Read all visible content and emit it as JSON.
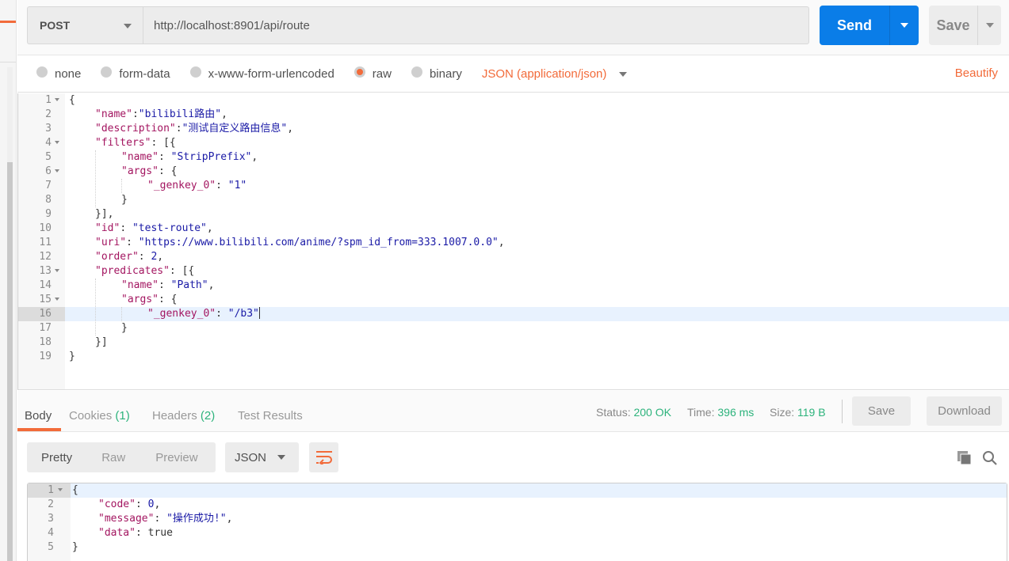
{
  "request": {
    "method": "POST",
    "url": "http://localhost:8901/api/route",
    "send_label": "Send",
    "save_label": "Save"
  },
  "body_options": {
    "modes": [
      {
        "label": "none",
        "selected": false
      },
      {
        "label": "form-data",
        "selected": false
      },
      {
        "label": "x-www-form-urlencoded",
        "selected": false
      },
      {
        "label": "raw",
        "selected": true
      },
      {
        "label": "binary",
        "selected": false
      }
    ],
    "content_type": "JSON (application/json)",
    "beautify_label": "Beautify"
  },
  "request_body": {
    "active_line": 16,
    "lines": [
      {
        "n": "1",
        "fold": true,
        "indent": 0,
        "tokens": [
          [
            "p",
            "{"
          ]
        ]
      },
      {
        "n": "2",
        "fold": false,
        "indent": 1,
        "tokens": [
          [
            "k",
            "\"name\""
          ],
          [
            "p",
            ":"
          ],
          [
            "s",
            "\"bilibili路由\""
          ],
          [
            "p",
            ","
          ]
        ]
      },
      {
        "n": "3",
        "fold": false,
        "indent": 1,
        "tokens": [
          [
            "k",
            "\"description\""
          ],
          [
            "p",
            ":"
          ],
          [
            "s",
            "\"测试自定义路由信息\""
          ],
          [
            "p",
            ","
          ]
        ]
      },
      {
        "n": "4",
        "fold": true,
        "indent": 1,
        "tokens": [
          [
            "k",
            "\"filters\""
          ],
          [
            "p",
            ": [{"
          ]
        ]
      },
      {
        "n": "5",
        "fold": false,
        "indent": 2,
        "tokens": [
          [
            "k",
            "\"name\""
          ],
          [
            "p",
            ": "
          ],
          [
            "s",
            "\"StripPrefix\""
          ],
          [
            "p",
            ","
          ]
        ]
      },
      {
        "n": "6",
        "fold": true,
        "indent": 2,
        "tokens": [
          [
            "k",
            "\"args\""
          ],
          [
            "p",
            ": {"
          ]
        ]
      },
      {
        "n": "7",
        "fold": false,
        "indent": 3,
        "tokens": [
          [
            "k",
            "\"_genkey_0\""
          ],
          [
            "p",
            ": "
          ],
          [
            "s",
            "\"1\""
          ]
        ]
      },
      {
        "n": "8",
        "fold": false,
        "indent": 2,
        "tokens": [
          [
            "p",
            "}"
          ]
        ]
      },
      {
        "n": "9",
        "fold": false,
        "indent": 1,
        "tokens": [
          [
            "p",
            "}],"
          ]
        ]
      },
      {
        "n": "10",
        "fold": false,
        "indent": 1,
        "tokens": [
          [
            "k",
            "\"id\""
          ],
          [
            "p",
            ": "
          ],
          [
            "s",
            "\"test-route\""
          ],
          [
            "p",
            ","
          ]
        ]
      },
      {
        "n": "11",
        "fold": false,
        "indent": 1,
        "tokens": [
          [
            "k",
            "\"uri\""
          ],
          [
            "p",
            ": "
          ],
          [
            "s",
            "\"https://www.bilibili.com/anime/?spm_id_from=333.1007.0.0\""
          ],
          [
            "p",
            ","
          ]
        ]
      },
      {
        "n": "12",
        "fold": false,
        "indent": 1,
        "tokens": [
          [
            "k",
            "\"order\""
          ],
          [
            "p",
            ": "
          ],
          [
            "n",
            "2"
          ],
          [
            "p",
            ","
          ]
        ]
      },
      {
        "n": "13",
        "fold": true,
        "indent": 1,
        "tokens": [
          [
            "k",
            "\"predicates\""
          ],
          [
            "p",
            ": [{"
          ]
        ]
      },
      {
        "n": "14",
        "fold": false,
        "indent": 2,
        "tokens": [
          [
            "k",
            "\"name\""
          ],
          [
            "p",
            ": "
          ],
          [
            "s",
            "\"Path\""
          ],
          [
            "p",
            ","
          ]
        ]
      },
      {
        "n": "15",
        "fold": true,
        "indent": 2,
        "tokens": [
          [
            "k",
            "\"args\""
          ],
          [
            "p",
            ": {"
          ]
        ]
      },
      {
        "n": "16",
        "fold": false,
        "indent": 3,
        "tokens": [
          [
            "k",
            "\"_genkey_0\""
          ],
          [
            "p",
            ": "
          ],
          [
            "s",
            "\"/b3\""
          ]
        ]
      },
      {
        "n": "17",
        "fold": false,
        "indent": 2,
        "tokens": [
          [
            "p",
            "}"
          ]
        ]
      },
      {
        "n": "18",
        "fold": false,
        "indent": 1,
        "tokens": [
          [
            "p",
            "}]"
          ]
        ]
      },
      {
        "n": "19",
        "fold": false,
        "indent": 0,
        "tokens": [
          [
            "p",
            "}"
          ]
        ]
      }
    ]
  },
  "response": {
    "tabs": [
      {
        "label": "Body",
        "count": "",
        "active": true
      },
      {
        "label": "Cookies",
        "count": "(1)",
        "active": false
      },
      {
        "label": "Headers",
        "count": "(2)",
        "active": false
      },
      {
        "label": "Test Results",
        "count": "",
        "active": false
      }
    ],
    "status_label": "Status:",
    "status_value": "200 OK",
    "time_label": "Time:",
    "time_value": "396 ms",
    "size_label": "Size:",
    "size_value": "119 B",
    "save_label": "Save",
    "download_label": "Download",
    "view_modes": [
      {
        "label": "Pretty",
        "active": true
      },
      {
        "label": "Raw",
        "active": false
      },
      {
        "label": "Preview",
        "active": false
      }
    ],
    "format": "JSON",
    "icons": {
      "wrap": "wrap-lines-icon",
      "copy": "copy-icon",
      "search": "search-icon"
    },
    "accent_color": "#f26b3a",
    "status_color": "#2db37c",
    "body": {
      "active_line": 1,
      "lines": [
        {
          "n": "1",
          "fold": true,
          "indent": 0,
          "tokens": [
            [
              "p",
              "{"
            ]
          ]
        },
        {
          "n": "2",
          "fold": false,
          "indent": 1,
          "tokens": [
            [
              "k",
              "\"code\""
            ],
            [
              "p",
              ": "
            ],
            [
              "n",
              "0"
            ],
            [
              "p",
              ","
            ]
          ]
        },
        {
          "n": "3",
          "fold": false,
          "indent": 1,
          "tokens": [
            [
              "k",
              "\"message\""
            ],
            [
              "p",
              ": "
            ],
            [
              "s",
              "\"操作成功!\""
            ],
            [
              "p",
              ","
            ]
          ]
        },
        {
          "n": "4",
          "fold": false,
          "indent": 1,
          "tokens": [
            [
              "k",
              "\"data\""
            ],
            [
              "p",
              ": true"
            ]
          ]
        },
        {
          "n": "5",
          "fold": false,
          "indent": 0,
          "tokens": [
            [
              "p",
              "}"
            ]
          ]
        }
      ]
    }
  }
}
